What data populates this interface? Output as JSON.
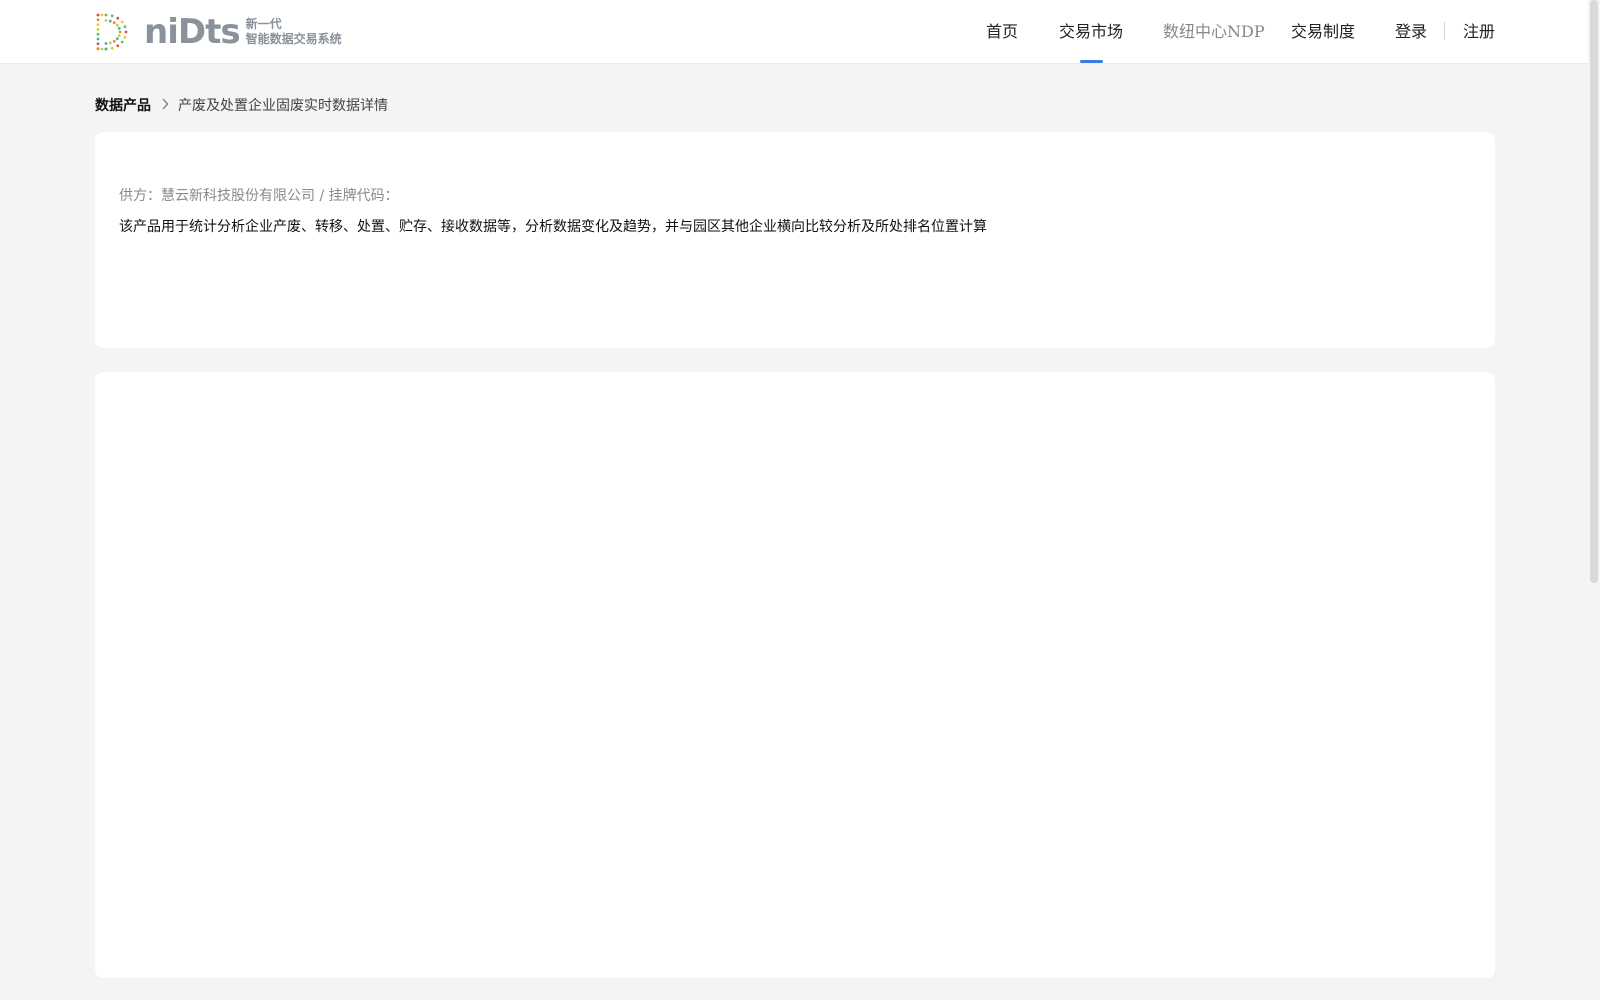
{
  "header": {
    "logo": {
      "word": "niDts",
      "sub_line1": "新一代",
      "sub_line2": "智能数据交易系统"
    },
    "nav": {
      "home": "首页",
      "market": "交易市场",
      "ndp": "数纽中心NDP",
      "rules": "交易制度",
      "login": "登录",
      "register": "注册"
    },
    "active_nav": "交易市场",
    "accent_color": "#3a7de8"
  },
  "breadcrumb": {
    "root": "数据产品",
    "separator_icon": "chevron-right-icon",
    "current": "产废及处置企业固废实时数据详情"
  },
  "product": {
    "supplier_line": "供方：慧云新科技股份有限公司 / 挂牌代码：",
    "description": "该产品用于统计分析企业产废、转移、处置、贮存、接收数据等，分析数据变化及趋势，并与园区其他企业横向比较分析及所处排名位置计算"
  }
}
